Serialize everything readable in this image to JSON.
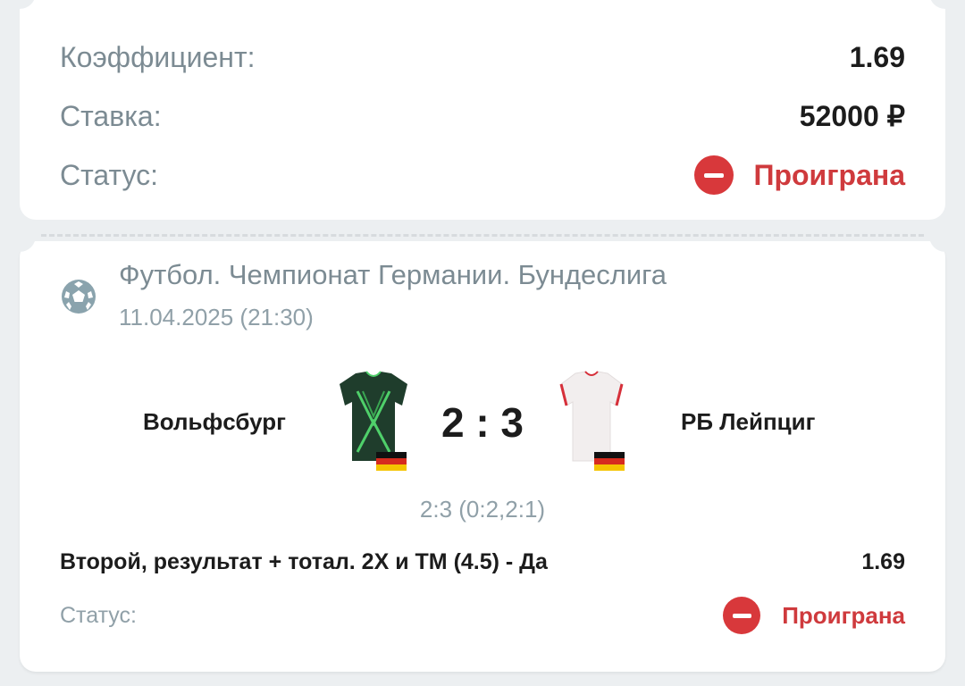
{
  "summary": {
    "coefficient_label": "Коэффициент:",
    "coefficient_value": "1.69",
    "stake_label": "Ставка:",
    "stake_value": "52000 ₽",
    "status_label": "Статус:",
    "status_value": "Проиграна"
  },
  "event": {
    "league": "Футбол. Чемпионат Германии. Бундеслига",
    "datetime": "11.04.2025 (21:30)",
    "home_team": "Вольфсбург",
    "away_team": "РБ Лейпциг",
    "score": "2 : 3",
    "period_scores": "2:3 (0:2,2:1)",
    "market": "Второй, результат + тотал. 2Х и ТМ (4.5) - Да",
    "market_odds": "1.69",
    "status_label": "Статус:",
    "status_value": "Проиграна"
  },
  "icons": {
    "league": "soccer-ball-icon",
    "status": "minus-circle-icon",
    "flag": "germany-flag-icon"
  },
  "colors": {
    "lost_status": "#cf3a3d",
    "home_jersey": "#1f3d2c",
    "home_jersey_accent": "#4fd06a",
    "away_jersey": "#f2eeee",
    "away_jersey_accent": "#d6303a"
  }
}
